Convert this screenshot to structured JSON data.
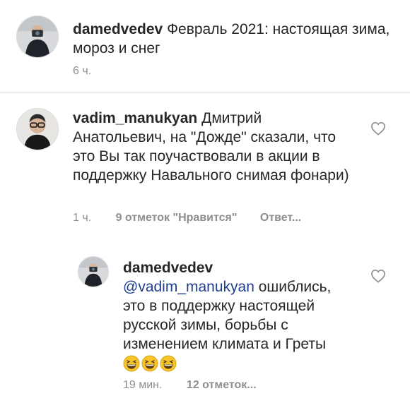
{
  "post_caption": {
    "username": "damedvedev",
    "text": "Февраль 2021: настоящая зима, мороз и снег",
    "time": "6 ч."
  },
  "comments": [
    {
      "username": "vadim_manukyan",
      "text": "Дмитрий Анатольевич, на \"Дожде\" сказали, что это Вы так поучаствовали в акции в поддержку Навального снимая фонари)",
      "time": "1 ч.",
      "likes": "9 отметок \"Нравится\"",
      "reply": "Ответ..."
    },
    {
      "username": "damedvedev",
      "mention": "@vadim_manukyan",
      "text": "ошиблись, это в поддержку настоящей русской зимы, борьбы с изменением климата и Греты",
      "emoji": [
        "grinning-squinting-face",
        "grinning-squinting-face",
        "grinning-squinting-face"
      ],
      "time": "19 мин.",
      "likes": "12 отметок..."
    }
  ],
  "colors": {
    "text": "#262626",
    "meta": "#8e8e8e",
    "mention": "#1f3f8f",
    "divider": "#dbdbdb",
    "emoji": "#f7c42a"
  },
  "icons": [
    "heart-outline-icon",
    "grinning-squinting-face"
  ]
}
